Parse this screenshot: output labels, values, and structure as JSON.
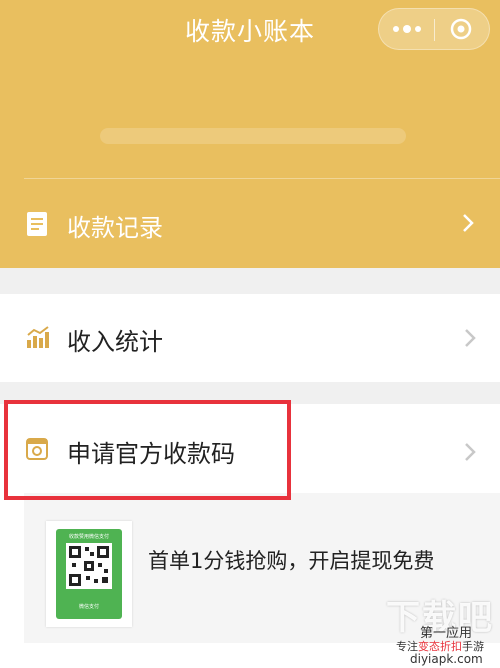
{
  "app": {
    "title": "收款小账本"
  },
  "menu": {
    "records": {
      "label": "收款记录"
    },
    "stats": {
      "label": "收入统计"
    },
    "apply": {
      "label": "申请官方收款码"
    }
  },
  "promo": {
    "text": "首单1分钱抢购，开启提现免费",
    "card_caption": "收款赞用微信支付",
    "card_footer": "微信支付"
  },
  "watermark": {
    "big": "下载吧",
    "line1": "第一应用",
    "line2_prefix": "专注",
    "line2_highlight": "变态折扣",
    "line2_suffix": "手游",
    "line3": "diyiapk.com"
  },
  "colors": {
    "header": "#e9bf5f",
    "highlight_border": "#e8323c",
    "qr_green": "#4fb352"
  }
}
